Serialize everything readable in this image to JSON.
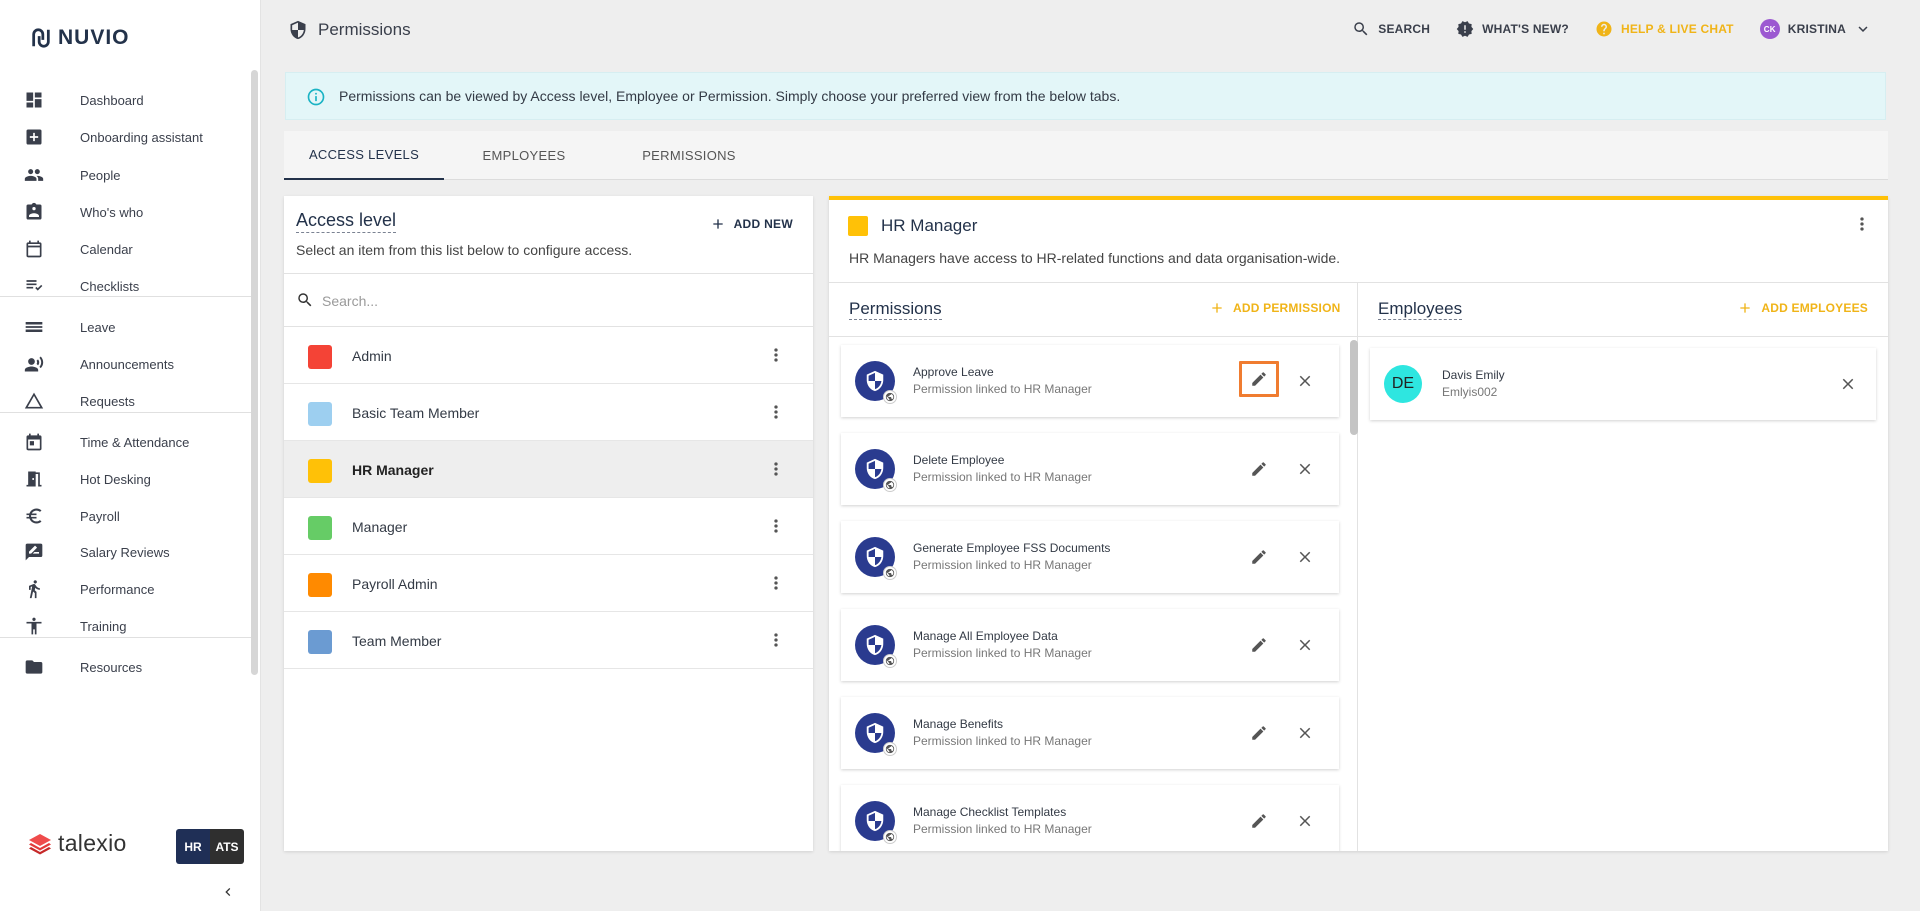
{
  "brand": {
    "name": "NUVIO"
  },
  "sidebar": {
    "items": [
      {
        "label": "Dashboard",
        "icon": "dashboard-icon"
      },
      {
        "label": "Onboarding assistant",
        "icon": "onboarding-icon"
      },
      {
        "label": "People",
        "icon": "people-icon"
      },
      {
        "label": "Who's who",
        "icon": "contact-card-icon"
      },
      {
        "label": "Calendar",
        "icon": "calendar-icon"
      },
      {
        "label": "Checklists",
        "icon": "checklist-icon"
      },
      {
        "label": "Leave",
        "icon": "leave-icon"
      },
      {
        "label": "Announcements",
        "icon": "announcement-icon"
      },
      {
        "label": "Requests",
        "icon": "requests-icon"
      },
      {
        "label": "Time & Attendance",
        "icon": "time-attendance-icon"
      },
      {
        "label": "Hot Desking",
        "icon": "hot-desking-icon"
      },
      {
        "label": "Payroll",
        "icon": "euro-icon"
      },
      {
        "label": "Salary Reviews",
        "icon": "salary-review-icon"
      },
      {
        "label": "Performance",
        "icon": "performance-icon"
      },
      {
        "label": "Training",
        "icon": "training-icon"
      },
      {
        "label": "Resources",
        "icon": "folder-icon"
      }
    ],
    "footer": {
      "logo_text": "talexio",
      "hr_label": "HR",
      "ats_label": "ATS"
    }
  },
  "header": {
    "title": "Permissions",
    "search_label": "SEARCH",
    "whats_new_label": "WHAT'S NEW?",
    "help_label": "HELP & LIVE CHAT",
    "user_initials": "CK",
    "user_name": "KRISTINA"
  },
  "info_banner": {
    "text": "Permissions can be viewed by Access level, Employee or Permission. Simply choose your preferred view from the below tabs."
  },
  "tabs": [
    {
      "label": "ACCESS LEVELS",
      "active": true
    },
    {
      "label": "EMPLOYEES",
      "active": false
    },
    {
      "label": "PERMISSIONS",
      "active": false
    }
  ],
  "access_panel": {
    "title": "Access level",
    "add_new_label": "ADD NEW",
    "subtitle": "Select an item from this list below to configure access.",
    "search_placeholder": "Search...",
    "items": [
      {
        "name": "Admin",
        "color": "#f44336"
      },
      {
        "name": "Basic Team Member",
        "color": "#9dcff0"
      },
      {
        "name": "HR Manager",
        "color": "#ffc107",
        "selected": true
      },
      {
        "name": "Manager",
        "color": "#66cc66"
      },
      {
        "name": "Payroll Admin",
        "color": "#ff8a00"
      },
      {
        "name": "Team Member",
        "color": "#6b9bd2"
      }
    ]
  },
  "detail": {
    "title": "HR Manager",
    "color": "#ffc107",
    "description": "HR Managers have access to HR-related functions and data organisation-wide.",
    "permissions_title": "Permissions",
    "add_permission_label": "ADD PERMISSION",
    "employees_title": "Employees",
    "add_employees_label": "ADD EMPLOYEES",
    "permissions": [
      {
        "name": "Approve Leave",
        "subtitle": "Permission linked to HR Manager"
      },
      {
        "name": "Delete Employee",
        "subtitle": "Permission linked to HR Manager"
      },
      {
        "name": "Generate Employee FSS Documents",
        "subtitle": "Permission linked to HR Manager"
      },
      {
        "name": "Manage All Employee Data",
        "subtitle": "Permission linked to HR Manager"
      },
      {
        "name": "Manage Benefits",
        "subtitle": "Permission linked to HR Manager"
      },
      {
        "name": "Manage Checklist Templates",
        "subtitle": "Permission linked to HR Manager"
      }
    ],
    "employees": [
      {
        "initials": "DE",
        "name": "Davis Emily",
        "username": "Emlyis002"
      }
    ]
  }
}
